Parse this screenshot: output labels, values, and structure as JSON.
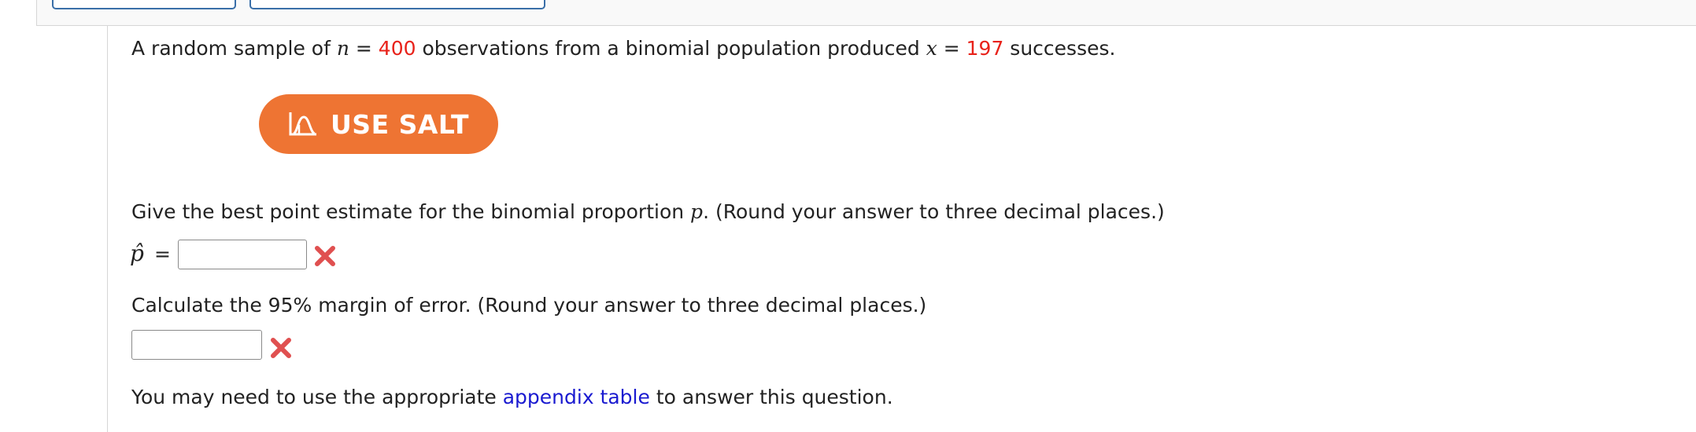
{
  "problem": {
    "intro_prefix": "A random sample of ",
    "n_symbol": "n",
    "eq": " = ",
    "n_value": "400",
    "intro_middle": " observations from a binomial population produced ",
    "x_symbol": "x",
    "x_value": "197",
    "intro_suffix": " successes."
  },
  "salt_button": {
    "label": "USE SALT"
  },
  "question1": {
    "prefix": "Give the best point estimate for the binomial proportion ",
    "p_symbol": "p",
    "suffix": ". (Round your answer to three decimal places.)",
    "label_symbol": "p̂",
    "label_eq": "=",
    "input_value": ""
  },
  "question2": {
    "text": "Calculate the 95% margin of error. (Round your answer to three decimal places.)",
    "input_value": ""
  },
  "footer": {
    "prefix": "You may need to use the appropriate ",
    "link_text": "appendix table",
    "suffix": " to answer this question."
  },
  "colors": {
    "highlight_red": "#e8221a",
    "salt_orange": "#ee7433",
    "link_blue": "#1a1ad0",
    "wrong_mark": "#e05050"
  },
  "icons": {
    "salt": "salt-distribution-icon",
    "wrong": "wrong-answer-x-icon"
  }
}
